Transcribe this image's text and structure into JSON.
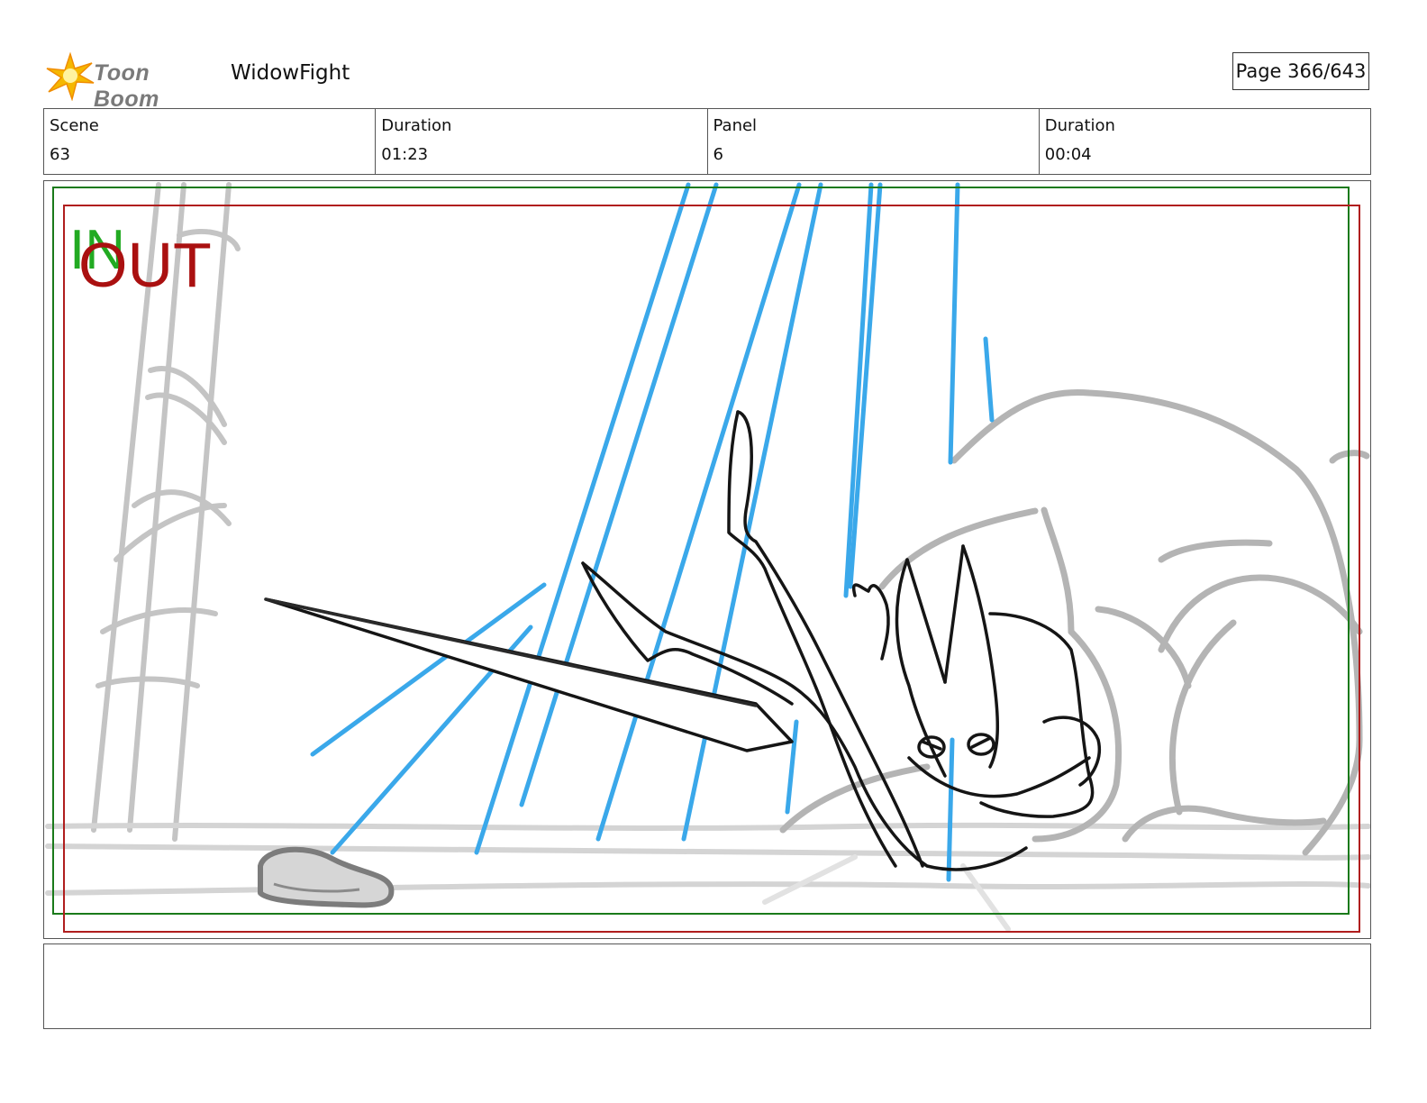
{
  "header": {
    "logo_text": "Toon Boom",
    "project_title": "WidowFight",
    "page_label": "Page 366/643"
  },
  "info": {
    "scene_label": "Scene",
    "scene_value": "63",
    "scene_duration_label": "Duration",
    "scene_duration_value": "01:23",
    "panel_label": "Panel",
    "panel_value": "6",
    "panel_duration_label": "Duration",
    "panel_duration_value": "00:04"
  },
  "panel": {
    "in_marker": "IN",
    "out_marker": "OUT"
  },
  "colors": {
    "in_frame": "#1a7a1a",
    "out_frame": "#b01e1e",
    "in_text": "#22aa22",
    "out_text": "#aa1010",
    "speed_lines": "#3aa8ea",
    "sketch_gray": "#b8b8b8",
    "logo_star": "#f5b800"
  },
  "notes": {
    "text": ""
  }
}
